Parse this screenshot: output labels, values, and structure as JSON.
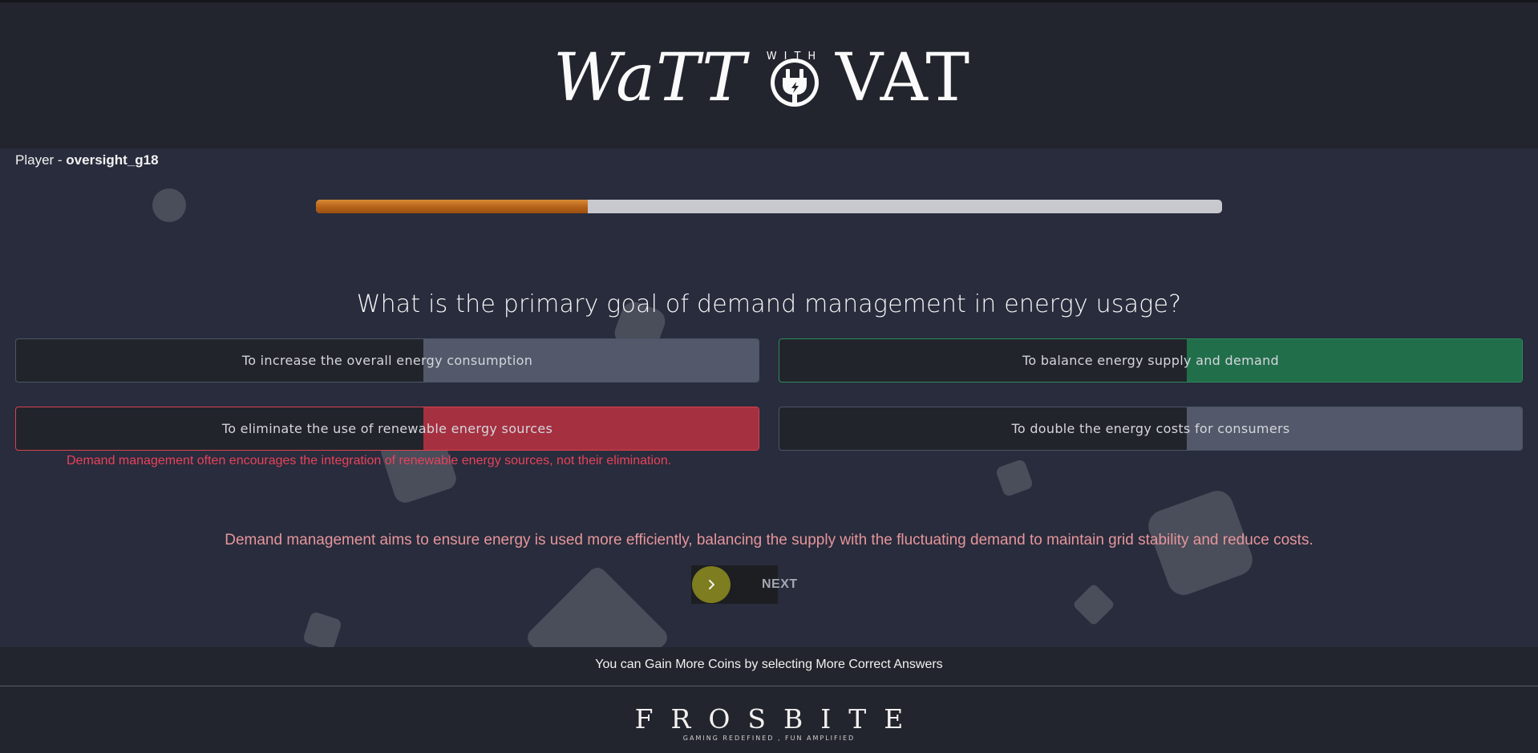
{
  "header": {
    "logo_left": "WaTT",
    "logo_with": "WITH",
    "logo_right": "VAT"
  },
  "player": {
    "prefix": "Player - ",
    "name": "oversight_g18"
  },
  "progress": {
    "value_percent": 30
  },
  "quiz": {
    "question": "What is the primary goal of demand management in energy usage?",
    "options": [
      {
        "label": "To increase the overall energy consumption",
        "state": "neutral"
      },
      {
        "label": "To balance energy supply and demand",
        "state": "correct"
      },
      {
        "label": "To eliminate the use of renewable energy sources",
        "state": "wrong"
      },
      {
        "label": "To double the energy costs for consumers",
        "state": "neutral"
      }
    ],
    "wrong_explanation": "Demand management often encourages the integration of renewable energy sources, not their elimination.",
    "explanation": "Demand management aims to ensure energy is used more efficiently, balancing the supply with the fluctuating demand to maintain grid stability and reduce costs.",
    "next_label": "NEXT"
  },
  "hint": "You can Gain More Coins by selecting More Correct Answers",
  "footer": {
    "brand": "FROSBITE",
    "tagline": "GAMING REDEFINED , FUN AMPLIFIED"
  },
  "colors": {
    "progress_fill": "#b46219",
    "correct": "#216e4b",
    "wrong": "#a53040",
    "next_button": "#7e7d1f"
  },
  "icons": {
    "logo_emblem": "plug-icon",
    "next": "chevron-right-icon"
  }
}
